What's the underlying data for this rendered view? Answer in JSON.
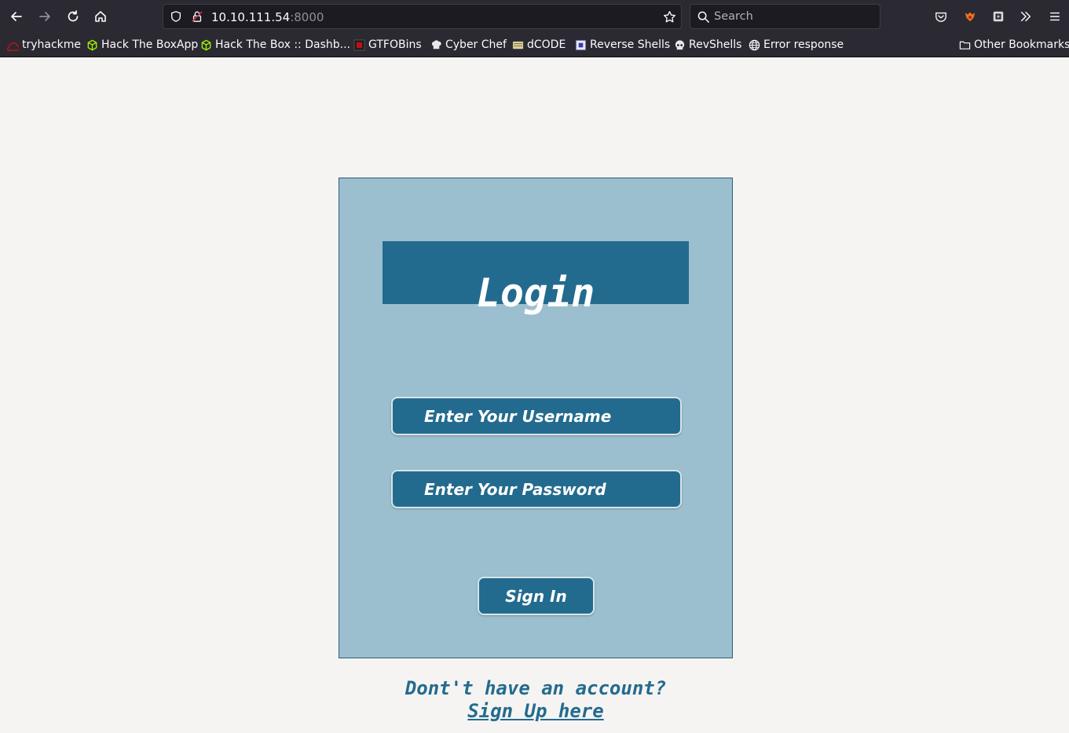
{
  "browser": {
    "url_host": "10.10.111.54",
    "url_port": ":8000",
    "search_placeholder": "Search",
    "bookmarks": [
      {
        "label": "tryhackme",
        "icon": "tryhackme-icon"
      },
      {
        "label": "Hack The BoxApp",
        "icon": "htb-cube-icon"
      },
      {
        "label": "Hack The Box :: Dashb...",
        "icon": "htb-cube-icon"
      },
      {
        "label": "GTFOBins",
        "icon": "gtfobins-icon"
      },
      {
        "label": "Cyber Chef",
        "icon": "chef-hat-icon"
      },
      {
        "label": "dCODE",
        "icon": "dcode-icon"
      },
      {
        "label": "Reverse Shells",
        "icon": "reverse-shells-icon"
      },
      {
        "label": "RevShells",
        "icon": "skull-icon"
      },
      {
        "label": "Error response",
        "icon": "globe-icon"
      }
    ],
    "other_bookmarks": "Other Bookmarks"
  },
  "login": {
    "title": "Login",
    "username_placeholder": "Enter Your Username",
    "password_placeholder": "Enter Your Password",
    "signin_label": "Sign In",
    "no_account_text": "Dont't have an account?",
    "signup_link": "Sign Up here"
  },
  "colors": {
    "card_bg": "#9bbfce",
    "accent": "#236b8e",
    "page_bg": "#f5f4f2"
  }
}
